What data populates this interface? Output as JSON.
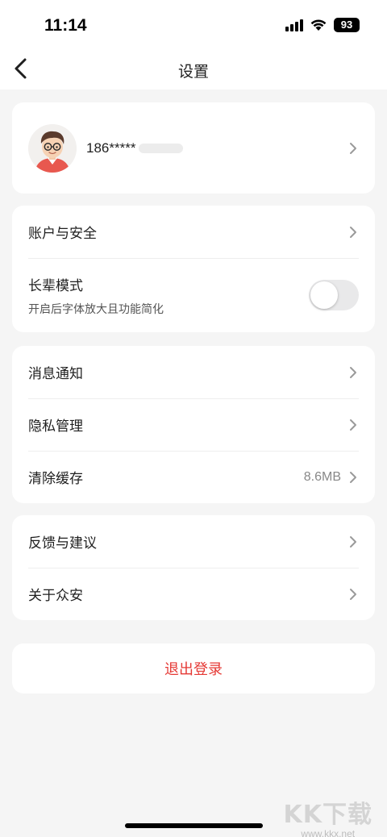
{
  "status_bar": {
    "time": "11:14",
    "battery": "93"
  },
  "nav": {
    "title": "设置"
  },
  "profile": {
    "phone": "186*****"
  },
  "security_section": {
    "account_label": "账户与安全",
    "elder_mode": {
      "title": "长辈模式",
      "subtitle": "开启后字体放大且功能简化",
      "enabled": false
    }
  },
  "general_section": {
    "notifications_label": "消息通知",
    "privacy_label": "隐私管理",
    "cache_label": "清除缓存",
    "cache_size": "8.6MB"
  },
  "about_section": {
    "feedback_label": "反馈与建议",
    "about_label": "关于众安"
  },
  "logout": {
    "label": "退出登录"
  },
  "watermark": {
    "main": "KK下载",
    "sub": "www.kkx.net"
  },
  "colors": {
    "background": "#f5f5f5",
    "card": "#ffffff",
    "logout_text": "#e53935",
    "toggle_off": "#e9e9ea"
  }
}
